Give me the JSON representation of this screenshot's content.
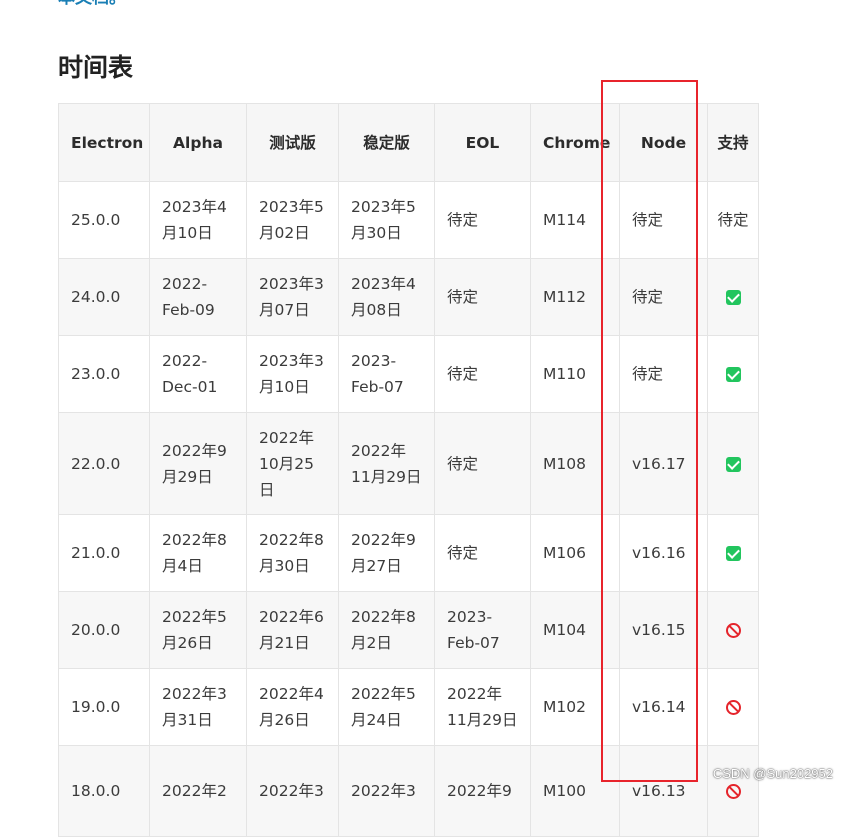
{
  "page": {
    "top_link": "本文档。",
    "section_title": "时间表",
    "watermark": "CSDN @Sun202952"
  },
  "table": {
    "headers": [
      "Electron",
      "Alpha",
      "测试版",
      "稳定版",
      "EOL",
      "Chrome",
      "Node",
      "支持"
    ],
    "rows": [
      {
        "electron": "25.0.0",
        "alpha": "2023年4月10日",
        "beta": "2023年5月02日",
        "stable": "2023年5月30日",
        "eol": "待定",
        "chrome": "M114",
        "node": "待定",
        "support_text": "待定",
        "support": "text"
      },
      {
        "electron": "24.0.0",
        "alpha": "2022-Feb-09",
        "beta": "2023年3月07日",
        "stable": "2023年4月08日",
        "eol": "待定",
        "chrome": "M112",
        "node": "待定",
        "support_text": "",
        "support": "check"
      },
      {
        "electron": "23.0.0",
        "alpha": "2022-Dec-01",
        "beta": "2023年3月10日",
        "stable": "2023-Feb-07",
        "eol": "待定",
        "chrome": "M110",
        "node": "待定",
        "support_text": "",
        "support": "check"
      },
      {
        "electron": "22.0.0",
        "alpha": "2022年9月29日",
        "beta": "2022年10月25日",
        "stable": "2022年11月29日",
        "eol": "待定",
        "chrome": "M108",
        "node": "v16.17",
        "support_text": "",
        "support": "check"
      },
      {
        "electron": "21.0.0",
        "alpha": "2022年8月4日",
        "beta": "2022年8月30日",
        "stable": "2022年9月27日",
        "eol": "待定",
        "chrome": "M106",
        "node": "v16.16",
        "support_text": "",
        "support": "check"
      },
      {
        "electron": "20.0.0",
        "alpha": "2022年5月26日",
        "beta": "2022年6月21日",
        "stable": "2022年8月2日",
        "eol": "2023-Feb-07",
        "chrome": "M104",
        "node": "v16.15",
        "support_text": "",
        "support": "no"
      },
      {
        "electron": "19.0.0",
        "alpha": "2022年3月31日",
        "beta": "2022年4月26日",
        "stable": "2022年5月24日",
        "eol": "2022年11月29日",
        "chrome": "M102",
        "node": "v16.14",
        "support_text": "",
        "support": "no"
      },
      {
        "electron": "18.0.0",
        "alpha": "2022年2",
        "beta": "2022年3",
        "stable": "2022年3",
        "eol": "2022年9",
        "chrome": "M100",
        "node": "v16.13",
        "support_text": "",
        "support": "no"
      }
    ]
  },
  "colors": {
    "support_check": "#22c55e",
    "support_no": "#e5242b",
    "highlight_box": "#e8242c",
    "link": "#1a7fb5"
  }
}
